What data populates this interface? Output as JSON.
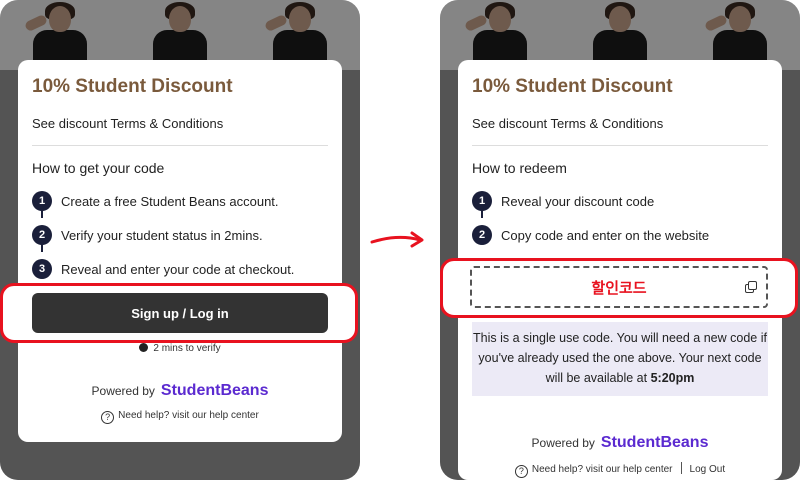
{
  "colors": {
    "accent_red": "#e8121f",
    "title_brown": "#7a5a3c",
    "brand_purple": "#5b2ad0",
    "step_badge": "#1a1f3a",
    "button_dark": "#333333"
  },
  "left": {
    "title": "10% Student Discount",
    "terms": "See discount Terms & Conditions",
    "how_heading": "How to get your code",
    "steps": [
      {
        "num": "1",
        "text": "Create a free Student Beans account."
      },
      {
        "num": "2",
        "text": "Verify your student status in 2mins."
      },
      {
        "num": "3",
        "text": "Reveal and enter your code at checkout."
      }
    ],
    "signup_button": "Sign up / Log in",
    "verify_note": "2 mins to verify",
    "powered_by": "Powered by",
    "brand": "StudentBeans",
    "help": "Need help? visit our help center"
  },
  "right": {
    "title": "10% Student Discount",
    "terms": "See discount Terms & Conditions",
    "how_heading": "How to redeem",
    "steps": [
      {
        "num": "1",
        "text": "Reveal your discount code"
      },
      {
        "num": "2",
        "text": "Copy code and enter on the website"
      }
    ],
    "code_label": "할인코드",
    "note_text": "This is a single use code. You will need a new code if you've already used the one above. Your next code will be available at",
    "note_time": "5:20pm",
    "powered_by": "Powered by",
    "brand": "StudentBeans",
    "help": "Need help? visit our help center",
    "logout": "Log Out"
  }
}
